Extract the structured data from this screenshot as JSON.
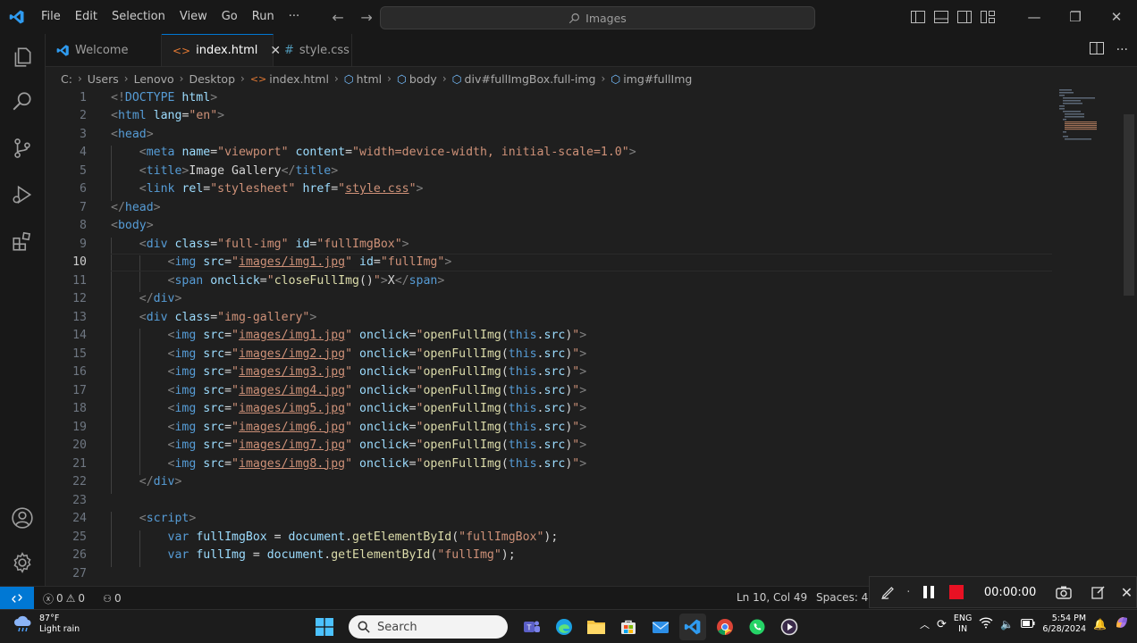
{
  "titlebar": {
    "menu": [
      "File",
      "Edit",
      "Selection",
      "View",
      "Go",
      "Run",
      "···"
    ],
    "command_center": "Images"
  },
  "tabs": [
    {
      "label": "Welcome",
      "active": false
    },
    {
      "label": "index.html",
      "active": true
    },
    {
      "label": "style.css",
      "active": false
    }
  ],
  "breadcrumb": [
    "C:",
    "Users",
    "Lenovo",
    "Desktop",
    "index.html",
    "html",
    "body",
    "div#fullImgBox.full-img",
    "img#fullImg"
  ],
  "editor": {
    "current_line": 10,
    "lines": [
      "<!DOCTYPE html>",
      "<html lang=\"en\">",
      "<head>",
      "    <meta name=\"viewport\" content=\"width=device-width, initial-scale=1.0\">",
      "    <title>Image Gallery</title>",
      "    <link rel=\"stylesheet\" href=\"style.css\">",
      "</head>",
      "<body>",
      "    <div class=\"full-img\" id=\"fullImgBox\">",
      "        <img src=\"images/img1.jpg\" id=\"fullImg\">",
      "        <span onclick=\"closeFullImg()\">X</span>",
      "    </div>",
      "    <div class=\"img-gallery\">",
      "        <img src=\"images/img1.jpg\" onclick=\"openFullImg(this.src)\">",
      "        <img src=\"images/img2.jpg\" onclick=\"openFullImg(this.src)\">",
      "        <img src=\"images/img3.jpg\" onclick=\"openFullImg(this.src)\">",
      "        <img src=\"images/img4.jpg\" onclick=\"openFullImg(this.src)\">",
      "        <img src=\"images/img5.jpg\" onclick=\"openFullImg(this.src)\">",
      "        <img src=\"images/img6.jpg\" onclick=\"openFullImg(this.src)\">",
      "        <img src=\"images/img7.jpg\" onclick=\"openFullImg(this.src)\">",
      "        <img src=\"images/img8.jpg\" onclick=\"openFullImg(this.src)\">",
      "    </div>",
      "",
      "    <script>",
      "        var fullImgBox = document.getElementById(\"fullImgBox\");",
      "        var fullImg = document.getElementById(\"fullImg\");",
      ""
    ]
  },
  "statusbar": {
    "errors": "0",
    "warnings": "0",
    "ports": "0",
    "position": "Ln 10, Col 49",
    "spaces": "Spaces: 4"
  },
  "recorder": {
    "time": "00:00:00"
  },
  "taskbar": {
    "weather_temp": "87°F",
    "weather_desc": "Light rain",
    "search_placeholder": "Search",
    "lang_top": "ENG",
    "lang_bottom": "IN",
    "time": "5:54 PM",
    "date": "6/28/2024"
  },
  "colors": {
    "accent": "#0078d4",
    "background": "#1f1f1f",
    "record": "#e81123"
  }
}
